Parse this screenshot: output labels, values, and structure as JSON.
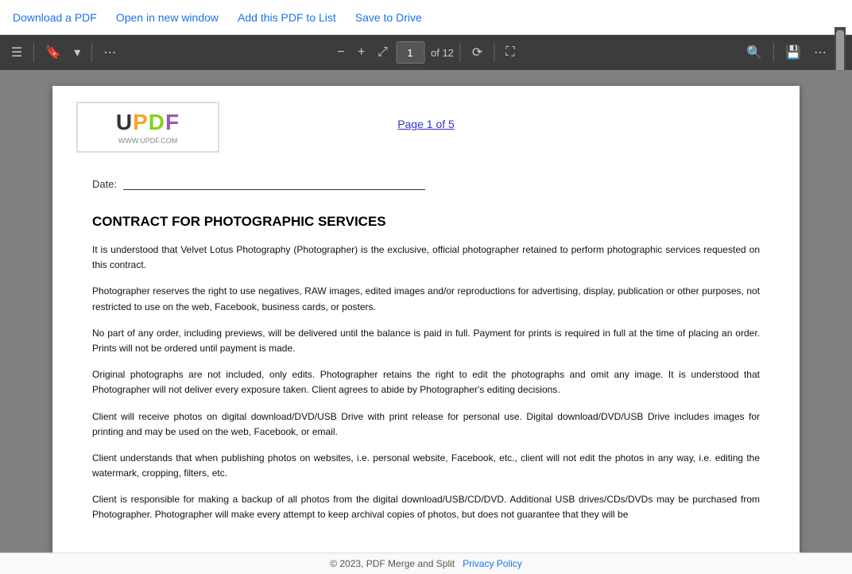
{
  "topbar": {
    "download_label": "Download a PDF",
    "open_new_window_label": "Open in new window",
    "add_to_list_label": "Add this PDF to List",
    "save_to_drive_label": "Save to Drive"
  },
  "toolbar": {
    "page_current": "1",
    "page_total": "of 12",
    "zoom_icon": "⟳",
    "fit_icon": "⛶",
    "search_icon": "🔍",
    "save_icon": "💾",
    "more_icon": "⋯",
    "list_icon": "☰",
    "bookmark_icon": "🔖",
    "expand_icon": "⤢",
    "minus_icon": "−",
    "plus_icon": "+"
  },
  "pdf": {
    "watermark_text": "UPDF",
    "watermark_url": "WWW.UPDF.COM",
    "page_indicator": "Page 1 of 5",
    "date_label": "Date:",
    "contract_title": "CONTRACT FOR PHOTOGRAPHIC SERVICES",
    "paragraphs": [
      "It is understood that Velvet Lotus Photography (Photographer) is the exclusive, official photographer retained to perform photographic services requested on this contract.",
      "Photographer reserves the right to use negatives, RAW images, edited images and/or reproductions for advertising, display, publication or other purposes, not restricted to use on the web, Facebook, business cards, or posters.",
      "No part of any order, including previews, will be delivered until the balance is paid in full. Payment for prints is required in full at the time of placing an order. Prints will not be ordered until payment is made.",
      "Original photographs are not included, only edits. Photographer retains the right to edit the photographs and omit any image. It is understood that Photographer will not deliver every exposure taken. Client agrees to abide by Photographer's editing decisions.",
      "Client will receive photos on digital download/DVD/USB Drive with print release for personal use. Digital download/DVD/USB Drive includes images for printing and may be used on the web, Facebook, or email.",
      "Client understands that when publishing photos on websites, i.e. personal website, Facebook, etc., client will not edit the photos in any way, i.e. editing the watermark, cropping, filters, etc.",
      "Client is responsible for making a backup of all photos from the digital download/USB/CD/DVD. Additional USB drives/CDs/DVDs may be purchased from Photographer. Photographer will make every attempt to keep archival copies of photos, but does not guarantee that they will be"
    ]
  },
  "footer": {
    "copyright": "© 2023, PDF Merge and Split",
    "privacy_link": "Privacy Policy"
  }
}
